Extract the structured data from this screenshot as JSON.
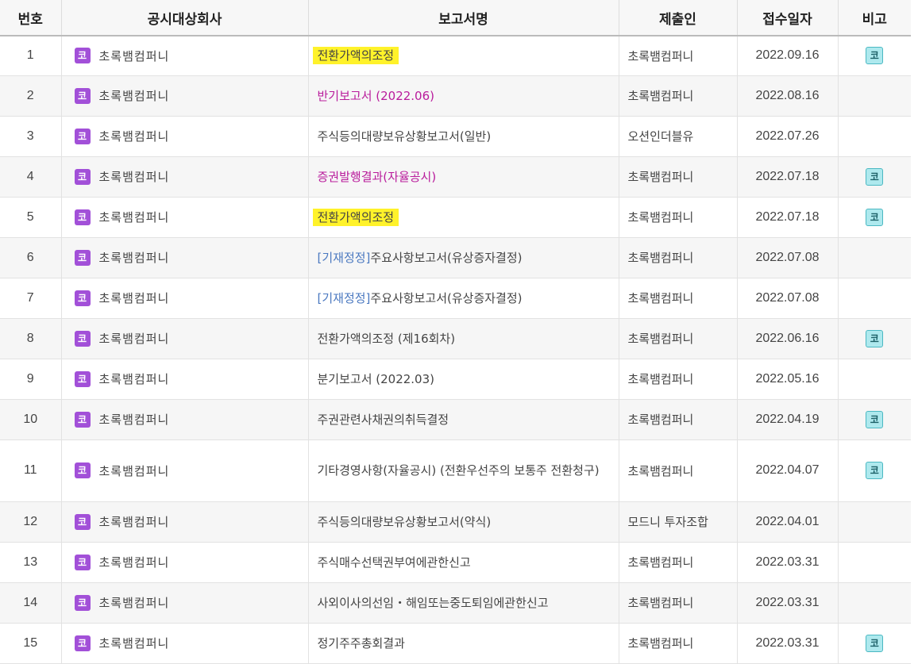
{
  "headers": {
    "num": "번호",
    "company": "공시대상회사",
    "report": "보고서명",
    "submitter": "제출인",
    "date": "접수일자",
    "remark": "비고"
  },
  "colors": {
    "company_badge": "#a250d8",
    "remark_badge": "#aee9ee",
    "highlight": "#fff22a",
    "purple_text": "#b91c9c",
    "blue_tag": "#4a78c0"
  },
  "rows": [
    {
      "num": "1",
      "badge": "코",
      "company": "초록뱀컴퍼니",
      "tag": "",
      "report": "전환가액의조정",
      "submitter": "초록뱀컴퍼니",
      "date": "2022.09.16",
      "remark": "코"
    },
    {
      "num": "2",
      "badge": "코",
      "company": "초록뱀컴퍼니",
      "tag": "",
      "report": "반기보고서 (2022.06)",
      "submitter": "초록뱀컴퍼니",
      "date": "2022.08.16",
      "remark": ""
    },
    {
      "num": "3",
      "badge": "코",
      "company": "초록뱀컴퍼니",
      "tag": "",
      "report": "주식등의대량보유상황보고서(일반)",
      "submitter": "오션인더블유",
      "date": "2022.07.26",
      "remark": ""
    },
    {
      "num": "4",
      "badge": "코",
      "company": "초록뱀컴퍼니",
      "tag": "",
      "report": "증권발행결과(자율공시)",
      "submitter": "초록뱀컴퍼니",
      "date": "2022.07.18",
      "remark": "코"
    },
    {
      "num": "5",
      "badge": "코",
      "company": "초록뱀컴퍼니",
      "tag": "",
      "report": "전환가액의조정",
      "submitter": "초록뱀컴퍼니",
      "date": "2022.07.18",
      "remark": "코"
    },
    {
      "num": "6",
      "badge": "코",
      "company": "초록뱀컴퍼니",
      "tag": "[기재정정]",
      "report": "주요사항보고서(유상증자결정)",
      "submitter": "초록뱀컴퍼니",
      "date": "2022.07.08",
      "remark": ""
    },
    {
      "num": "7",
      "badge": "코",
      "company": "초록뱀컴퍼니",
      "tag": "[기재정정]",
      "report": "주요사항보고서(유상증자결정)",
      "submitter": "초록뱀컴퍼니",
      "date": "2022.07.08",
      "remark": ""
    },
    {
      "num": "8",
      "badge": "코",
      "company": "초록뱀컴퍼니",
      "tag": "",
      "report": "전환가액의조정 (제16회차)",
      "submitter": "초록뱀컴퍼니",
      "date": "2022.06.16",
      "remark": "코"
    },
    {
      "num": "9",
      "badge": "코",
      "company": "초록뱀컴퍼니",
      "tag": "",
      "report": "분기보고서 (2022.03)",
      "submitter": "초록뱀컴퍼니",
      "date": "2022.05.16",
      "remark": ""
    },
    {
      "num": "10",
      "badge": "코",
      "company": "초록뱀컴퍼니",
      "tag": "",
      "report": "주권관련사채권의취득결정",
      "submitter": "초록뱀컴퍼니",
      "date": "2022.04.19",
      "remark": "코"
    },
    {
      "num": "11",
      "badge": "코",
      "company": "초록뱀컴퍼니",
      "tag": "",
      "report": "기타경영사항(자율공시) (전환우선주의 보통주 전환청구)",
      "submitter": "초록뱀컴퍼니",
      "date": "2022.04.07",
      "remark": "코"
    },
    {
      "num": "12",
      "badge": "코",
      "company": "초록뱀컴퍼니",
      "tag": "",
      "report": "주식등의대량보유상황보고서(약식)",
      "submitter": "모드니 투자조합",
      "date": "2022.04.01",
      "remark": ""
    },
    {
      "num": "13",
      "badge": "코",
      "company": "초록뱀컴퍼니",
      "tag": "",
      "report": "주식매수선택권부여에관한신고",
      "submitter": "초록뱀컴퍼니",
      "date": "2022.03.31",
      "remark": ""
    },
    {
      "num": "14",
      "badge": "코",
      "company": "초록뱀컴퍼니",
      "tag": "",
      "report": "사외이사의선임・해임또는중도퇴임에관한신고",
      "submitter": "초록뱀컴퍼니",
      "date": "2022.03.31",
      "remark": ""
    },
    {
      "num": "15",
      "badge": "코",
      "company": "초록뱀컴퍼니",
      "tag": "",
      "report": "정기주주총회결과",
      "submitter": "초록뱀컴퍼니",
      "date": "2022.03.31",
      "remark": "코"
    }
  ]
}
